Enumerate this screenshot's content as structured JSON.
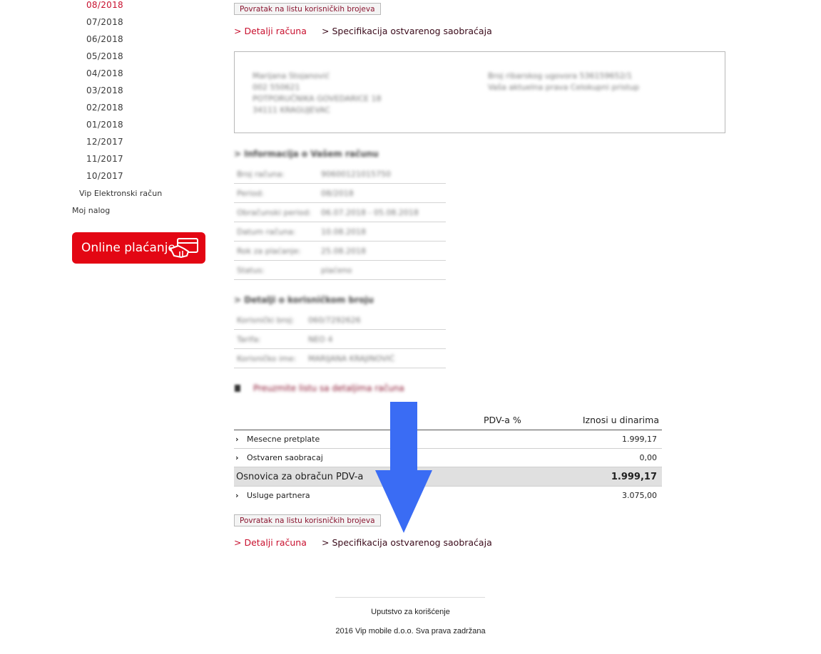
{
  "sidebar": {
    "months": [
      "08/2018",
      "07/2018",
      "06/2018",
      "05/2018",
      "04/2018",
      "03/2018",
      "02/2018",
      "01/2018",
      "12/2017",
      "11/2017",
      "10/2017"
    ],
    "active_month": "08/2018",
    "e_bill_label": "Vip Elektronski račun",
    "account_label": "Moj nalog",
    "online_pay_label": "Online plaćanje"
  },
  "nav": {
    "back_label": "Povratak na listu korisničkih brojeva",
    "details_label": "> Detalji računa",
    "spec_label": "> Specifikacija ostvarenog saobraćaja"
  },
  "customer_box": {
    "name": "Marijana Stojanović",
    "id": "002 550621",
    "street": "POTPORUČNIKA GOVEDARICE 18",
    "city": "34111 KRAGUJEVAC",
    "contract_line": "Broj ribarskog ugovora 536159652/1",
    "rights_line": "Vaša aktuelna prava Celokupni pristup"
  },
  "bill_info": {
    "title": "> Informacija o Vašem računu",
    "rows": [
      {
        "k": "Broj računa:",
        "v": "90600121015750"
      },
      {
        "k": "Period:",
        "v": "08/2018"
      },
      {
        "k": "Obračunski period:",
        "v": "06.07.2018 - 05.08.2018"
      },
      {
        "k": "Datum računa:",
        "v": "10.08.2018"
      },
      {
        "k": "Rok za plaćanje:",
        "v": "25.08.2018"
      },
      {
        "k": "Status:",
        "v": "plaćeno"
      }
    ]
  },
  "user_info": {
    "title": "> Detalji o korisničkom broju",
    "rows": [
      {
        "k": "Korisnički broj:",
        "v": "060/7292626"
      },
      {
        "k": "Tarifa:",
        "v": "NEO 4"
      },
      {
        "k": "Korisničko ime:",
        "v": "MARIJANA KRAJINOVIĆ"
      }
    ]
  },
  "download_label": "Preuzmite listu sa detaljima računa",
  "summary": {
    "headers": {
      "vat": "PDV-a %",
      "amount": "Iznosi u dinarima"
    },
    "rows": [
      {
        "label": "Mesecne pretplate",
        "amount": "1.999,17",
        "chev": "›"
      },
      {
        "label": "Ostvaren saobracaj",
        "amount": "0,00",
        "chev": "›"
      },
      {
        "label": "Osnovica za obračun PDV-a",
        "amount": "1.999,17",
        "chev": ""
      },
      {
        "label": "Usluge partnera",
        "amount": "3.075,00",
        "chev": "›"
      }
    ]
  },
  "footer": {
    "guide_label": "Uputstvo za korišćenje",
    "copyright": "2016 Vip mobile d.o.o. Sva prava zadržana"
  },
  "colors": {
    "brand_red": "#e30613",
    "link_red": "#c8102e",
    "arrow_blue": "#3a6cf4"
  }
}
